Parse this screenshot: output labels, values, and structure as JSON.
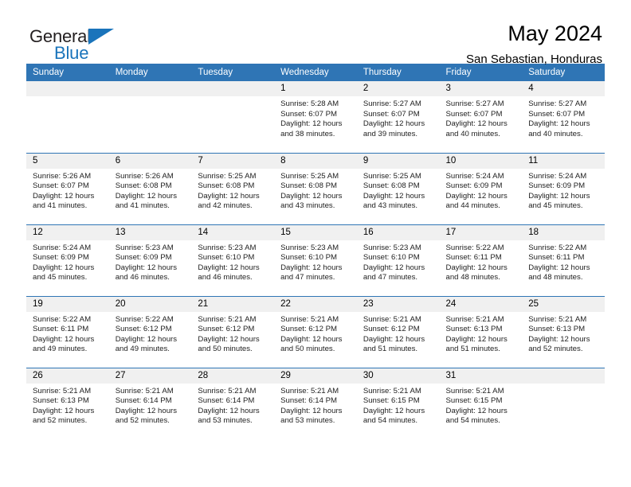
{
  "brand": {
    "logo_general": "General",
    "logo_blue": "Blue",
    "accent_color": "#2f75b5",
    "logo_blue_color": "#1a74bb",
    "header_bg": "#2f75b5",
    "daynum_bg": "#f0f0f0"
  },
  "header": {
    "title": "May 2024",
    "subtitle": "San Sebastian, Honduras"
  },
  "weekdays": [
    "Sunday",
    "Monday",
    "Tuesday",
    "Wednesday",
    "Thursday",
    "Friday",
    "Saturday"
  ],
  "weeks": [
    [
      {
        "day": "",
        "empty": true
      },
      {
        "day": "",
        "empty": true
      },
      {
        "day": "",
        "empty": true
      },
      {
        "day": "1",
        "sunrise": "Sunrise: 5:28 AM",
        "sunset": "Sunset: 6:07 PM",
        "daylight1": "Daylight: 12 hours",
        "daylight2": "and 38 minutes."
      },
      {
        "day": "2",
        "sunrise": "Sunrise: 5:27 AM",
        "sunset": "Sunset: 6:07 PM",
        "daylight1": "Daylight: 12 hours",
        "daylight2": "and 39 minutes."
      },
      {
        "day": "3",
        "sunrise": "Sunrise: 5:27 AM",
        "sunset": "Sunset: 6:07 PM",
        "daylight1": "Daylight: 12 hours",
        "daylight2": "and 40 minutes."
      },
      {
        "day": "4",
        "sunrise": "Sunrise: 5:27 AM",
        "sunset": "Sunset: 6:07 PM",
        "daylight1": "Daylight: 12 hours",
        "daylight2": "and 40 minutes."
      }
    ],
    [
      {
        "day": "5",
        "sunrise": "Sunrise: 5:26 AM",
        "sunset": "Sunset: 6:07 PM",
        "daylight1": "Daylight: 12 hours",
        "daylight2": "and 41 minutes."
      },
      {
        "day": "6",
        "sunrise": "Sunrise: 5:26 AM",
        "sunset": "Sunset: 6:08 PM",
        "daylight1": "Daylight: 12 hours",
        "daylight2": "and 41 minutes."
      },
      {
        "day": "7",
        "sunrise": "Sunrise: 5:25 AM",
        "sunset": "Sunset: 6:08 PM",
        "daylight1": "Daylight: 12 hours",
        "daylight2": "and 42 minutes."
      },
      {
        "day": "8",
        "sunrise": "Sunrise: 5:25 AM",
        "sunset": "Sunset: 6:08 PM",
        "daylight1": "Daylight: 12 hours",
        "daylight2": "and 43 minutes."
      },
      {
        "day": "9",
        "sunrise": "Sunrise: 5:25 AM",
        "sunset": "Sunset: 6:08 PM",
        "daylight1": "Daylight: 12 hours",
        "daylight2": "and 43 minutes."
      },
      {
        "day": "10",
        "sunrise": "Sunrise: 5:24 AM",
        "sunset": "Sunset: 6:09 PM",
        "daylight1": "Daylight: 12 hours",
        "daylight2": "and 44 minutes."
      },
      {
        "day": "11",
        "sunrise": "Sunrise: 5:24 AM",
        "sunset": "Sunset: 6:09 PM",
        "daylight1": "Daylight: 12 hours",
        "daylight2": "and 45 minutes."
      }
    ],
    [
      {
        "day": "12",
        "sunrise": "Sunrise: 5:24 AM",
        "sunset": "Sunset: 6:09 PM",
        "daylight1": "Daylight: 12 hours",
        "daylight2": "and 45 minutes."
      },
      {
        "day": "13",
        "sunrise": "Sunrise: 5:23 AM",
        "sunset": "Sunset: 6:09 PM",
        "daylight1": "Daylight: 12 hours",
        "daylight2": "and 46 minutes."
      },
      {
        "day": "14",
        "sunrise": "Sunrise: 5:23 AM",
        "sunset": "Sunset: 6:10 PM",
        "daylight1": "Daylight: 12 hours",
        "daylight2": "and 46 minutes."
      },
      {
        "day": "15",
        "sunrise": "Sunrise: 5:23 AM",
        "sunset": "Sunset: 6:10 PM",
        "daylight1": "Daylight: 12 hours",
        "daylight2": "and 47 minutes."
      },
      {
        "day": "16",
        "sunrise": "Sunrise: 5:23 AM",
        "sunset": "Sunset: 6:10 PM",
        "daylight1": "Daylight: 12 hours",
        "daylight2": "and 47 minutes."
      },
      {
        "day": "17",
        "sunrise": "Sunrise: 5:22 AM",
        "sunset": "Sunset: 6:11 PM",
        "daylight1": "Daylight: 12 hours",
        "daylight2": "and 48 minutes."
      },
      {
        "day": "18",
        "sunrise": "Sunrise: 5:22 AM",
        "sunset": "Sunset: 6:11 PM",
        "daylight1": "Daylight: 12 hours",
        "daylight2": "and 48 minutes."
      }
    ],
    [
      {
        "day": "19",
        "sunrise": "Sunrise: 5:22 AM",
        "sunset": "Sunset: 6:11 PM",
        "daylight1": "Daylight: 12 hours",
        "daylight2": "and 49 minutes."
      },
      {
        "day": "20",
        "sunrise": "Sunrise: 5:22 AM",
        "sunset": "Sunset: 6:12 PM",
        "daylight1": "Daylight: 12 hours",
        "daylight2": "and 49 minutes."
      },
      {
        "day": "21",
        "sunrise": "Sunrise: 5:21 AM",
        "sunset": "Sunset: 6:12 PM",
        "daylight1": "Daylight: 12 hours",
        "daylight2": "and 50 minutes."
      },
      {
        "day": "22",
        "sunrise": "Sunrise: 5:21 AM",
        "sunset": "Sunset: 6:12 PM",
        "daylight1": "Daylight: 12 hours",
        "daylight2": "and 50 minutes."
      },
      {
        "day": "23",
        "sunrise": "Sunrise: 5:21 AM",
        "sunset": "Sunset: 6:12 PM",
        "daylight1": "Daylight: 12 hours",
        "daylight2": "and 51 minutes."
      },
      {
        "day": "24",
        "sunrise": "Sunrise: 5:21 AM",
        "sunset": "Sunset: 6:13 PM",
        "daylight1": "Daylight: 12 hours",
        "daylight2": "and 51 minutes."
      },
      {
        "day": "25",
        "sunrise": "Sunrise: 5:21 AM",
        "sunset": "Sunset: 6:13 PM",
        "daylight1": "Daylight: 12 hours",
        "daylight2": "and 52 minutes."
      }
    ],
    [
      {
        "day": "26",
        "sunrise": "Sunrise: 5:21 AM",
        "sunset": "Sunset: 6:13 PM",
        "daylight1": "Daylight: 12 hours",
        "daylight2": "and 52 minutes."
      },
      {
        "day": "27",
        "sunrise": "Sunrise: 5:21 AM",
        "sunset": "Sunset: 6:14 PM",
        "daylight1": "Daylight: 12 hours",
        "daylight2": "and 52 minutes."
      },
      {
        "day": "28",
        "sunrise": "Sunrise: 5:21 AM",
        "sunset": "Sunset: 6:14 PM",
        "daylight1": "Daylight: 12 hours",
        "daylight2": "and 53 minutes."
      },
      {
        "day": "29",
        "sunrise": "Sunrise: 5:21 AM",
        "sunset": "Sunset: 6:14 PM",
        "daylight1": "Daylight: 12 hours",
        "daylight2": "and 53 minutes."
      },
      {
        "day": "30",
        "sunrise": "Sunrise: 5:21 AM",
        "sunset": "Sunset: 6:15 PM",
        "daylight1": "Daylight: 12 hours",
        "daylight2": "and 54 minutes."
      },
      {
        "day": "31",
        "sunrise": "Sunrise: 5:21 AM",
        "sunset": "Sunset: 6:15 PM",
        "daylight1": "Daylight: 12 hours",
        "daylight2": "and 54 minutes."
      },
      {
        "day": "",
        "empty": true
      }
    ]
  ]
}
